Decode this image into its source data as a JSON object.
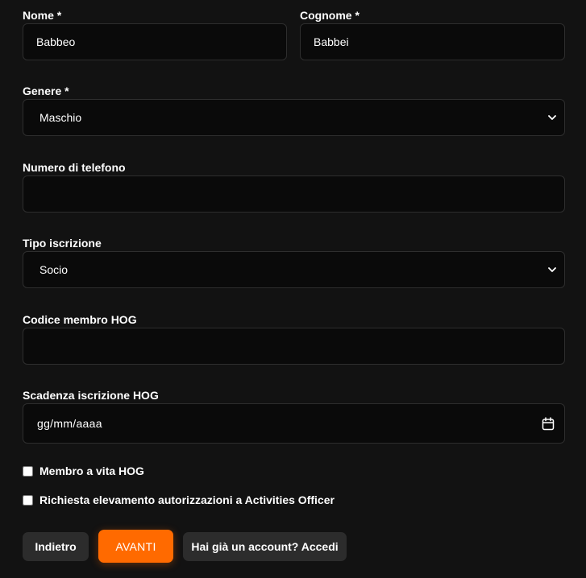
{
  "form": {
    "nome": {
      "label": "Nome *",
      "value": "Babbeo"
    },
    "cognome": {
      "label": "Cognome *",
      "value": "Babbei"
    },
    "genere": {
      "label": "Genere *",
      "selected": "Maschio"
    },
    "telefono": {
      "label": "Numero di telefono",
      "value": ""
    },
    "tipo_iscrizione": {
      "label": "Tipo iscrizione",
      "selected": "Socio"
    },
    "codice_hog": {
      "label": "Codice membro HOG",
      "value": ""
    },
    "scadenza_hog": {
      "label": "Scadenza iscrizione HOG",
      "placeholder": "gg/mm/aaaa"
    },
    "membro_vita": {
      "label": "Membro a vita HOG",
      "checked": false
    },
    "richiesta_officer": {
      "label": "Richiesta elevamento autorizzazioni a Activities Officer",
      "checked": false
    }
  },
  "actions": {
    "back_label": "Indietro",
    "next_label": "AVANTI",
    "login_label": "Hai già un account? Accedi"
  },
  "colors": {
    "background": "#121212",
    "field_bg": "#0a0a0a",
    "field_border": "#2e2e2e",
    "accent": "#ff6a00",
    "secondary_button": "#2c2c2c"
  },
  "icons": {
    "select_arrow": "chevron-down-icon",
    "date_picker": "calendar-icon"
  }
}
